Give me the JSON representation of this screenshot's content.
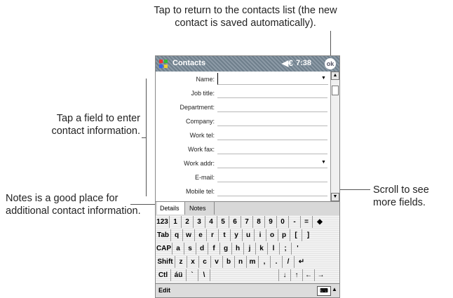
{
  "callouts": {
    "top": "Tap to return to the contacts list (the new contact is saved automatically).",
    "left": "Tap a field to enter contact information.",
    "notes": "Notes is a good place for additional contact information.",
    "scroll": "Scroll to see more fields."
  },
  "titlebar": {
    "app": "Contacts",
    "time": "7:38",
    "ok": "ok",
    "speaker": "◀€"
  },
  "fields": [
    "Name:",
    "Job title:",
    "Department:",
    "Company:",
    "Work tel:",
    "Work fax:",
    "Work addr:",
    "E-mail:",
    "Mobile tel:"
  ],
  "tabs": [
    "Details",
    "Notes"
  ],
  "keyboard": {
    "rows": [
      [
        "123",
        "1",
        "2",
        "3",
        "4",
        "5",
        "6",
        "7",
        "8",
        "9",
        "0",
        "-",
        "=",
        "◆"
      ],
      [
        "Tab",
        "q",
        "w",
        "e",
        "r",
        "t",
        "y",
        "u",
        "i",
        "o",
        "p",
        "[",
        "]"
      ],
      [
        "CAP",
        "a",
        "s",
        "d",
        "f",
        "g",
        "h",
        "j",
        "k",
        "l",
        ";",
        "'"
      ],
      [
        "Shift",
        "z",
        "x",
        "c",
        "v",
        "b",
        "n",
        "m",
        ",",
        ".",
        "/",
        "↵"
      ],
      [
        "Ctl",
        "áü",
        "`",
        "\\",
        "",
        "↓",
        "↑",
        "←",
        "→"
      ]
    ]
  },
  "menubar": {
    "edit": "Edit",
    "kb": "⌨",
    "up": "▲"
  },
  "icons": {
    "dropdown": "▼",
    "scroll_up": "▲",
    "scroll_down": "▼"
  }
}
